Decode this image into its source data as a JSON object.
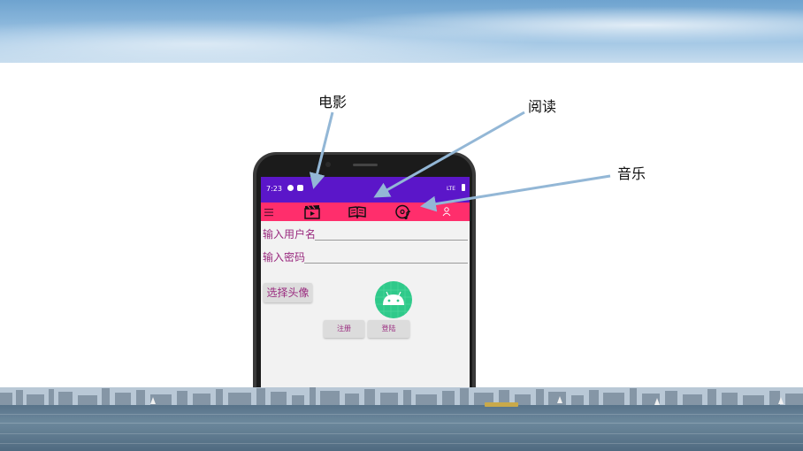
{
  "labels": {
    "movie": "电影",
    "reading": "阅读",
    "music": "音乐"
  },
  "status": {
    "time": "7:23",
    "network": "LTE"
  },
  "toolbar": {
    "icons": [
      "menu-icon",
      "movie-clapper-icon",
      "book-icon",
      "music-disc-icon",
      "person-icon"
    ]
  },
  "form": {
    "username_label": "输入用户名",
    "password_label": "输入密码"
  },
  "buttons": {
    "choose_avatar": "选择头像",
    "register": "注册",
    "login": "登陆"
  },
  "colors": {
    "status_bar": "#5b16c9",
    "toolbar": "#ff2e6c",
    "label_text": "#9a2b7f",
    "avatar_bg": "#2fc98a",
    "arrow": "#93b7d6"
  }
}
